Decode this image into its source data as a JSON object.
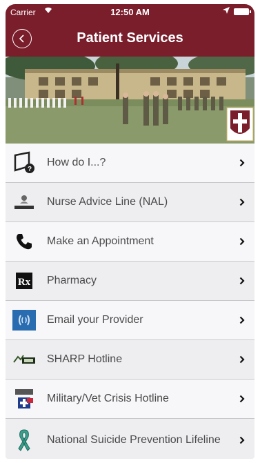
{
  "status_bar": {
    "carrier": "Carrier",
    "time": "12:50 AM"
  },
  "header": {
    "title": "Patient Services",
    "back_icon": "chevron-left-circle-icon"
  },
  "colors": {
    "header_bg": "#7a1e2c",
    "row_bg": "#f7f7f9",
    "row_alt_bg": "#eeeef1",
    "label_text": "#4a4a4a"
  },
  "menu": {
    "items": [
      {
        "label": "How do I...?",
        "icon": "question-doc-icon"
      },
      {
        "label": "Nurse Advice Line (NAL)",
        "icon": "nurse-logo-icon"
      },
      {
        "label": "Make an Appointment",
        "icon": "phone-icon"
      },
      {
        "label": "Pharmacy",
        "icon": "rx-icon"
      },
      {
        "label": "Email your Provider",
        "icon": "secure-messaging-icon"
      },
      {
        "label": "SHARP Hotline",
        "icon": "sharp-logo-icon"
      },
      {
        "label": "Military/Vet Crisis Hotline",
        "icon": "crisis-line-icon"
      },
      {
        "label": "National Suicide Prevention Lifeline",
        "icon": "awareness-ribbon-icon"
      }
    ]
  }
}
